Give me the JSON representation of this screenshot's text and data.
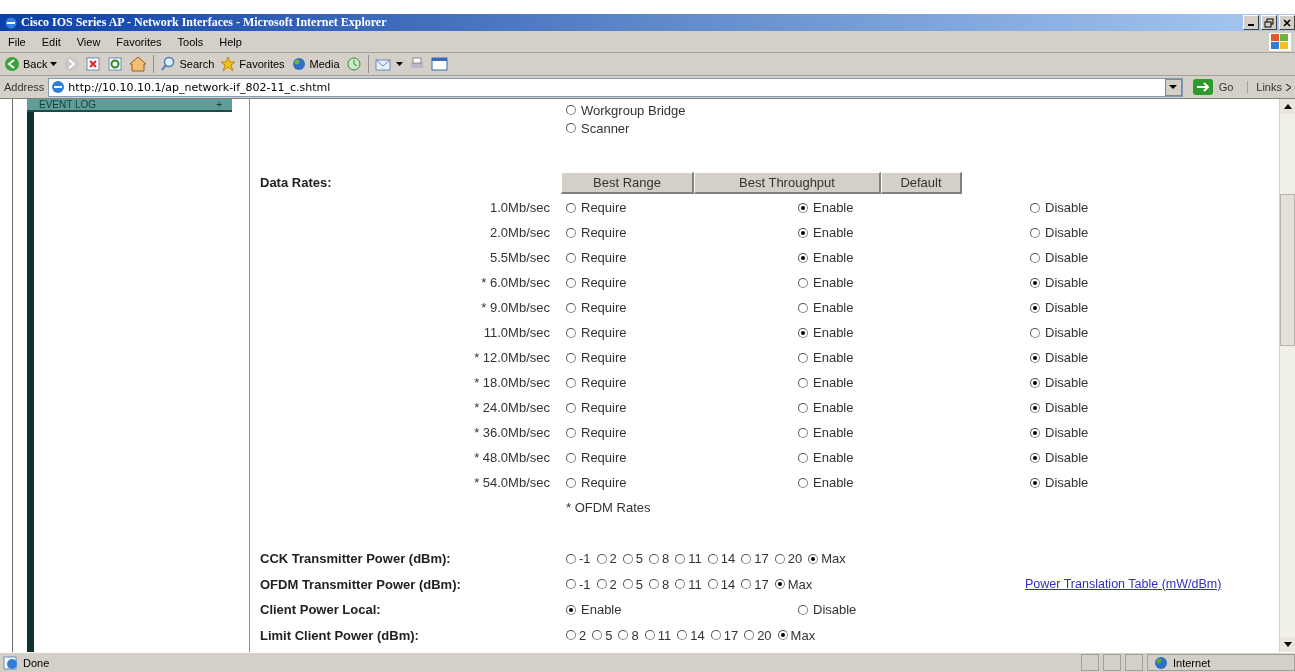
{
  "window": {
    "title": "Cisco IOS Series AP - Network Interfaces - Microsoft Internet Explorer"
  },
  "menu": [
    "File",
    "Edit",
    "View",
    "Favorites",
    "Tools",
    "Help"
  ],
  "toolbar": {
    "back": "Back",
    "search": "Search",
    "favorites": "Favorites",
    "media": "Media"
  },
  "address": {
    "label": "Address",
    "value": "http://10.10.10.1/ap_network-if_802-11_c.shtml",
    "go": "Go",
    "links": "Links"
  },
  "sidebar": {
    "item": "EVENT LOG",
    "toggle": "+"
  },
  "role_options": [
    {
      "label": "Workgroup Bridge",
      "selected": false
    },
    {
      "label": "Scanner",
      "selected": false
    }
  ],
  "data_rates": {
    "label": "Data Rates:",
    "buttons": [
      "Best Range",
      "Best Throughput",
      "Default"
    ],
    "rates": [
      {
        "label": "1.0Mb/sec",
        "options": [
          {
            "label": "Require",
            "selected": false
          },
          {
            "label": "Enable",
            "selected": true
          },
          {
            "label": "Disable",
            "selected": false
          }
        ]
      },
      {
        "label": "2.0Mb/sec",
        "options": [
          {
            "label": "Require",
            "selected": false
          },
          {
            "label": "Enable",
            "selected": true
          },
          {
            "label": "Disable",
            "selected": false
          }
        ]
      },
      {
        "label": "5.5Mb/sec",
        "options": [
          {
            "label": "Require",
            "selected": false
          },
          {
            "label": "Enable",
            "selected": true
          },
          {
            "label": "Disable",
            "selected": false
          }
        ]
      },
      {
        "label": "* 6.0Mb/sec",
        "options": [
          {
            "label": "Require",
            "selected": false
          },
          {
            "label": "Enable",
            "selected": false
          },
          {
            "label": "Disable",
            "selected": true
          }
        ]
      },
      {
        "label": "* 9.0Mb/sec",
        "options": [
          {
            "label": "Require",
            "selected": false
          },
          {
            "label": "Enable",
            "selected": false
          },
          {
            "label": "Disable",
            "selected": true
          }
        ]
      },
      {
        "label": "11.0Mb/sec",
        "options": [
          {
            "label": "Require",
            "selected": false
          },
          {
            "label": "Enable",
            "selected": true
          },
          {
            "label": "Disable",
            "selected": false
          }
        ]
      },
      {
        "label": "* 12.0Mb/sec",
        "options": [
          {
            "label": "Require",
            "selected": false
          },
          {
            "label": "Enable",
            "selected": false
          },
          {
            "label": "Disable",
            "selected": true
          }
        ]
      },
      {
        "label": "* 18.0Mb/sec",
        "options": [
          {
            "label": "Require",
            "selected": false
          },
          {
            "label": "Enable",
            "selected": false
          },
          {
            "label": "Disable",
            "selected": true
          }
        ]
      },
      {
        "label": "* 24.0Mb/sec",
        "options": [
          {
            "label": "Require",
            "selected": false
          },
          {
            "label": "Enable",
            "selected": false
          },
          {
            "label": "Disable",
            "selected": true
          }
        ]
      },
      {
        "label": "* 36.0Mb/sec",
        "options": [
          {
            "label": "Require",
            "selected": false
          },
          {
            "label": "Enable",
            "selected": false
          },
          {
            "label": "Disable",
            "selected": true
          }
        ]
      },
      {
        "label": "* 48.0Mb/sec",
        "options": [
          {
            "label": "Require",
            "selected": false
          },
          {
            "label": "Enable",
            "selected": false
          },
          {
            "label": "Disable",
            "selected": true
          }
        ]
      },
      {
        "label": "* 54.0Mb/sec",
        "options": [
          {
            "label": "Require",
            "selected": false
          },
          {
            "label": "Enable",
            "selected": false
          },
          {
            "label": "Disable",
            "selected": true
          }
        ]
      }
    ],
    "footnote": "* OFDM Rates"
  },
  "power_settings": [
    {
      "label": "CCK Transmitter Power (dBm):",
      "kind": "inline",
      "options": [
        {
          "label": "-1",
          "selected": false
        },
        {
          "label": "2",
          "selected": false
        },
        {
          "label": "5",
          "selected": false
        },
        {
          "label": "8",
          "selected": false
        },
        {
          "label": "11",
          "selected": false
        },
        {
          "label": "14",
          "selected": false
        },
        {
          "label": "17",
          "selected": false
        },
        {
          "label": "20",
          "selected": false
        },
        {
          "label": "Max",
          "selected": true
        }
      ]
    },
    {
      "label": "OFDM Transmitter Power (dBm):",
      "kind": "inline",
      "link": "Power Translation Table (mW/dBm)",
      "options": [
        {
          "label": "-1",
          "selected": false
        },
        {
          "label": "2",
          "selected": false
        },
        {
          "label": "5",
          "selected": false
        },
        {
          "label": "8",
          "selected": false
        },
        {
          "label": "11",
          "selected": false
        },
        {
          "label": "14",
          "selected": false
        },
        {
          "label": "17",
          "selected": false
        },
        {
          "label": "Max",
          "selected": true
        }
      ]
    },
    {
      "label": "Client Power Local:",
      "kind": "spaced",
      "options": [
        {
          "label": "Enable",
          "selected": true
        },
        {
          "label": "Disable",
          "selected": false
        }
      ]
    },
    {
      "label": "Limit Client Power (dBm):",
      "kind": "inline",
      "options": [
        {
          "label": "2",
          "selected": false
        },
        {
          "label": "5",
          "selected": false
        },
        {
          "label": "8",
          "selected": false
        },
        {
          "label": "11",
          "selected": false
        },
        {
          "label": "14",
          "selected": false
        },
        {
          "label": "17",
          "selected": false
        },
        {
          "label": "20",
          "selected": false
        },
        {
          "label": "Max",
          "selected": true
        }
      ]
    }
  ],
  "status": {
    "text": "Done",
    "zone": "Internet"
  }
}
